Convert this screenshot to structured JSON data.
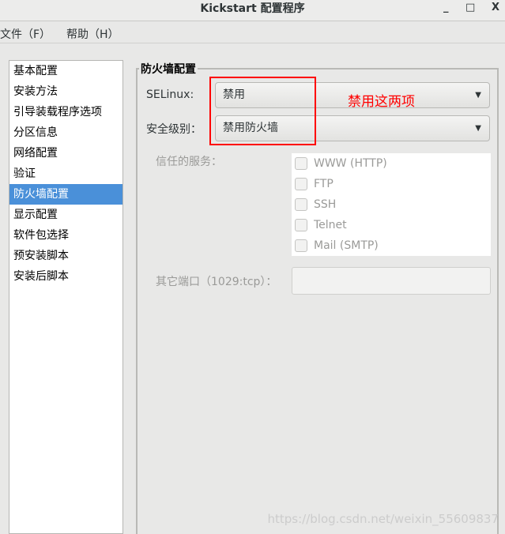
{
  "window": {
    "title": "Kickstart 配置程序",
    "minimize": "_",
    "maximize": "□",
    "close": "X"
  },
  "menu": [
    {
      "label": "文件（F）"
    },
    {
      "label": "帮助（H）"
    }
  ],
  "sidebar": {
    "selected": "防火墙配置",
    "items": [
      {
        "label": "基本配置"
      },
      {
        "label": "安装方法"
      },
      {
        "label": "引导装载程序选项"
      },
      {
        "label": "分区信息"
      },
      {
        "label": "网络配置"
      },
      {
        "label": "验证"
      },
      {
        "label": "防火墙配置"
      },
      {
        "label": "显示配置"
      },
      {
        "label": "软件包选择"
      },
      {
        "label": "预安装脚本"
      },
      {
        "label": "安装后脚本"
      }
    ]
  },
  "firewall": {
    "title": "防火墙配置",
    "selinux_label": "SELinux:",
    "selinux_value": "禁用",
    "security_label": "安全级别：",
    "security_value": "禁用防火墙",
    "trusted_label": "信任的服务：",
    "services": [
      {
        "label": "WWW (HTTP)",
        "checked": false
      },
      {
        "label": "FTP",
        "checked": false
      },
      {
        "label": "SSH",
        "checked": false
      },
      {
        "label": "Telnet",
        "checked": false
      },
      {
        "label": "Mail (SMTP)",
        "checked": false
      }
    ],
    "port_label": "其它端口（1029:tcp）：",
    "port_value": ""
  },
  "annotation": {
    "text": "禁用这两项",
    "color": "#ff0000"
  },
  "watermark": "https://blog.csdn.net/weixin_55609837",
  "colors": {
    "selection": "#4a90d9"
  }
}
